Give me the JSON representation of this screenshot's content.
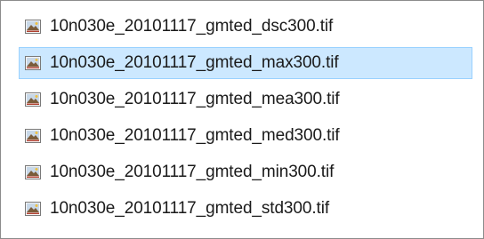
{
  "file_list": {
    "selected_index": 1,
    "items": [
      {
        "name": "10n030e_20101117_gmted_dsc300.tif",
        "icon": "tif-image-icon",
        "selected": false
      },
      {
        "name": "10n030e_20101117_gmted_max300.tif",
        "icon": "tif-image-icon",
        "selected": true
      },
      {
        "name": "10n030e_20101117_gmted_mea300.tif",
        "icon": "tif-image-icon",
        "selected": false
      },
      {
        "name": "10n030e_20101117_gmted_med300.tif",
        "icon": "tif-image-icon",
        "selected": false
      },
      {
        "name": "10n030e_20101117_gmted_min300.tif",
        "icon": "tif-image-icon",
        "selected": false
      },
      {
        "name": "10n030e_20101117_gmted_std300.tif",
        "icon": "tif-image-icon",
        "selected": false
      }
    ]
  },
  "colors": {
    "selection_fill": "#cce8ff",
    "selection_border": "#99d1ff",
    "frame_border": "#8c8c8c"
  }
}
